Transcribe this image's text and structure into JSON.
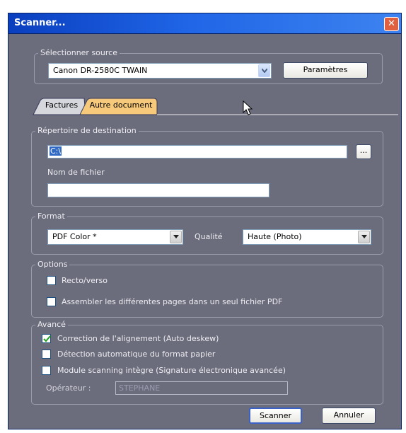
{
  "window": {
    "title": "Scanner...",
    "close_glyph": "✕"
  },
  "source": {
    "legend": "Sélectionner source",
    "selected": "Canon DR-2580C TWAIN",
    "params_button": "Paramètres"
  },
  "tabs": [
    {
      "label": "Factures",
      "active": false
    },
    {
      "label": "Autre document",
      "active": true
    }
  ],
  "destination": {
    "legend": "Répertoire de destination",
    "path_value": "C:\\",
    "browse_button": "...",
    "filename_label": "Nom de fichier",
    "filename_value": ""
  },
  "format": {
    "legend": "Format",
    "selected": "PDF Color *",
    "quality_label": "Qualité",
    "quality_selected": "Haute (Photo)"
  },
  "options": {
    "legend": "Options",
    "items": [
      {
        "label": "Recto/verso",
        "checked": false
      },
      {
        "label": "Assembler les différentes pages dans un seul fichier PDF",
        "checked": false
      }
    ]
  },
  "advanced": {
    "legend": "Avancé",
    "items": [
      {
        "label": "Correction de l'alignement (Auto deskew)",
        "checked": true
      },
      {
        "label": "Détection automatique du format papier",
        "checked": false
      },
      {
        "label": "Module scanning intègre (Signature électronique avancée)",
        "checked": false
      }
    ],
    "operator_label": "Opérateur :",
    "operator_value": "STEPHANE"
  },
  "footer": {
    "scan_button": "Scanner",
    "cancel_button": "Annuler"
  },
  "icons": {
    "close": "close-icon",
    "dropdown": "chevron-down-icon",
    "checkbox_check": "check-icon",
    "cursor": "mouse-pointer-icon"
  },
  "colors": {
    "dialog_bg": "#6b6c7c",
    "titlebar": "#1f65e6",
    "close_button": "#e06040",
    "active_tab": "#f7c97a",
    "check_mark": "#21a121"
  }
}
